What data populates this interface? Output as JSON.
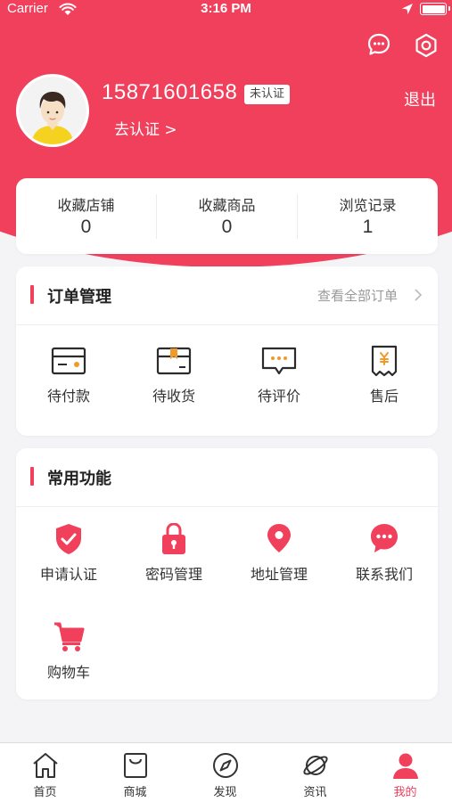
{
  "status_bar": {
    "carrier": "Carrier",
    "time": "3:16 PM"
  },
  "profile": {
    "phone": "15871601658",
    "cert_badge": "未认证",
    "go_cert": "去认证 >",
    "logout": "退出"
  },
  "stats": [
    {
      "label": "收藏店铺",
      "value": "0"
    },
    {
      "label": "收藏商品",
      "value": "0"
    },
    {
      "label": "浏览记录",
      "value": "1"
    }
  ],
  "orders": {
    "title": "订单管理",
    "view_all": "查看全部订单",
    "items": [
      {
        "label": "待付款",
        "icon": "wallet-card-icon"
      },
      {
        "label": "待收货",
        "icon": "package-box-icon"
      },
      {
        "label": "待评价",
        "icon": "comment-icon"
      },
      {
        "label": "售后",
        "icon": "receipt-icon"
      }
    ]
  },
  "functions": {
    "title": "常用功能",
    "items": [
      {
        "label": "申请认证",
        "icon": "shield-check-icon"
      },
      {
        "label": "密码管理",
        "icon": "lock-icon"
      },
      {
        "label": "地址管理",
        "icon": "location-pin-icon"
      },
      {
        "label": "联系我们",
        "icon": "chat-bubble-icon"
      },
      {
        "label": "购物车",
        "icon": "shopping-cart-icon"
      }
    ]
  },
  "tabbar": [
    {
      "label": "首页",
      "icon": "home-icon",
      "active": false
    },
    {
      "label": "商城",
      "icon": "shopping-bag-icon",
      "active": false
    },
    {
      "label": "发现",
      "icon": "compass-icon",
      "active": false
    },
    {
      "label": "资讯",
      "icon": "planet-icon",
      "active": false
    },
    {
      "label": "我的",
      "icon": "user-icon",
      "active": true
    }
  ],
  "colors": {
    "accent": "#f0405c",
    "background": "#f4f4f6",
    "card": "#ffffff"
  }
}
